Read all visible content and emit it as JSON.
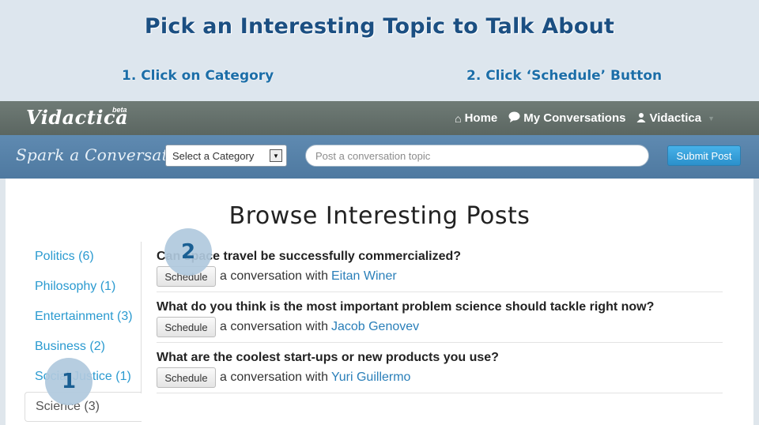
{
  "tutorial": {
    "title": "Pick an Interesting Topic to Talk About",
    "step1": "1. Click on Category",
    "step2": "2. Click ‘Schedule’ Button",
    "marker1": "1",
    "marker2": "2"
  },
  "navbar": {
    "logo": "Vidactica",
    "logo_badge": "beta",
    "home": "Home",
    "conversations": "My Conversations",
    "user": "Vidactica"
  },
  "spark": {
    "title": "Spark a Conversation",
    "category_select": "Select a Category",
    "topic_placeholder": "Post a conversation topic",
    "submit_label": "Submit Post"
  },
  "browse": {
    "title": "Browse Interesting Posts"
  },
  "categories": [
    {
      "label": "Politics (6)"
    },
    {
      "label": "Philosophy (1)"
    },
    {
      "label": "Entertainment (3)"
    },
    {
      "label": "Business (2)"
    },
    {
      "label": "Social Justice (1)"
    },
    {
      "label": "Science (3)"
    }
  ],
  "posts": [
    {
      "question": "Can space travel be successfully commercialized?",
      "button": "Schedule",
      "prefix": "a conversation with",
      "user": "Eitan Winer"
    },
    {
      "question": "What do you think is the most important problem science should tackle right now?",
      "button": "Schedule",
      "prefix": "a conversation with",
      "user": "Jacob Genovev"
    },
    {
      "question": "What are the coolest start-ups or new products you use?",
      "button": "Schedule",
      "prefix": "a conversation with",
      "user": "Yuri Guillermo"
    }
  ]
}
